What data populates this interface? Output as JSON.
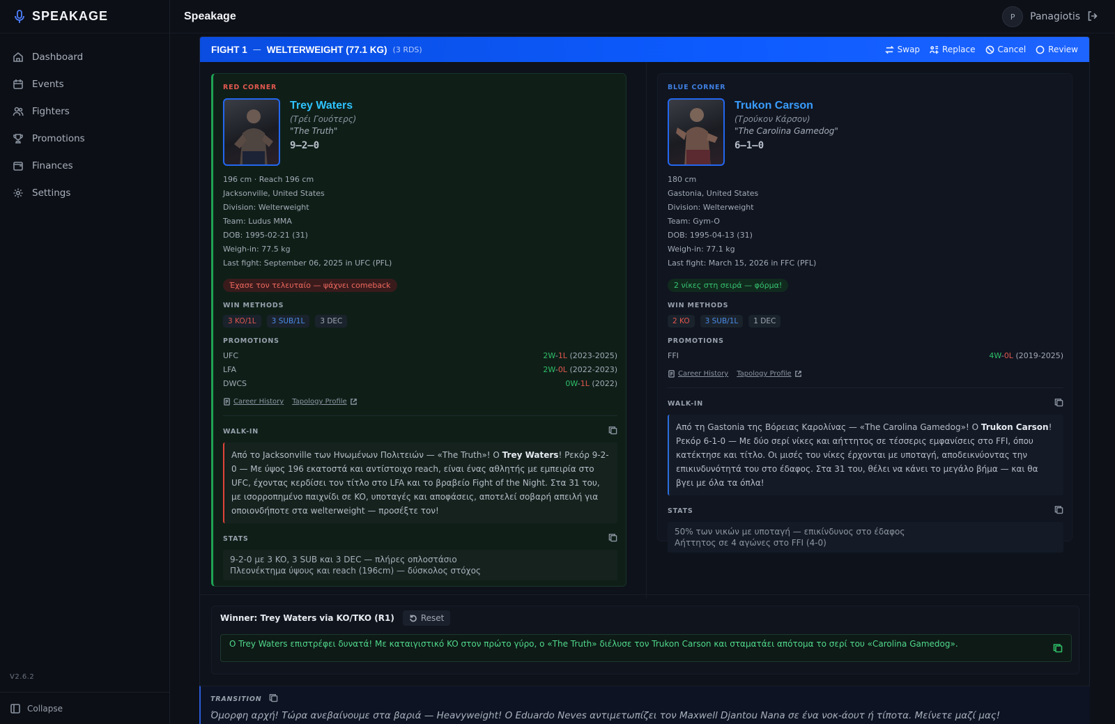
{
  "app": {
    "brand": "SPEAKAGE",
    "title": "Speakage",
    "version": "V2.6.2",
    "collapse_label": "Collapse"
  },
  "sidebar": {
    "items": [
      {
        "label": "Dashboard",
        "icon": "home-icon"
      },
      {
        "label": "Events",
        "icon": "calendar-icon"
      },
      {
        "label": "Fighters",
        "icon": "users-icon"
      },
      {
        "label": "Promotions",
        "icon": "trophy-icon"
      },
      {
        "label": "Finances",
        "icon": "wallet-icon"
      },
      {
        "label": "Settings",
        "icon": "gear-icon"
      }
    ]
  },
  "user": {
    "initial": "P",
    "name": "Panagiotis"
  },
  "fight": {
    "number": "FIGHT 1",
    "division": "WELTERWEIGHT (77.1 KG)",
    "rounds": "(3 RDS)",
    "actions": {
      "swap": "Swap",
      "replace": "Replace",
      "cancel": "Cancel",
      "review": "Review"
    },
    "red": {
      "corner_label": "RED CORNER",
      "name": "Trey Waters",
      "greek": "(Τρέι Γουότερς)",
      "nickname": "\"The Truth\"",
      "record": "9–2–0",
      "info": [
        "196 cm · Reach 196 cm",
        "Jacksonville, United States",
        "Division: Welterweight",
        "Team: Ludus MMA",
        "DOB: 1995-02-21 (31)",
        "Weigh-in: 77.5 kg",
        "Last fight: September 06, 2025 in UFC (PFL)"
      ],
      "badge": "Έχασε τον τελευταίο — ψάχνει comeback",
      "win_methods_label": "WIN METHODS",
      "methods": {
        "ko": "3 KO/1L",
        "sub": "3 SUB/1L",
        "dec": "3 DEC"
      },
      "promotions_label": "PROMOTIONS",
      "promotions": [
        {
          "name": "UFC",
          "w": "2W",
          "l": "1L",
          "years": "(2023-2025)"
        },
        {
          "name": "LFA",
          "w": "2W",
          "l": "0L",
          "years": "(2022-2023)"
        },
        {
          "name": "DWCS",
          "w": "0W",
          "l": "1L",
          "years": "(2022)"
        }
      ],
      "career_link": "Career History",
      "tapology_link": "Tapology Profile",
      "walkin_label": "WALK-IN",
      "walkin_pre": "Από το Jacksonville των Ηνωμένων Πολιτειών — «The Truth»! Ο ",
      "walkin_bold": "Trey Waters",
      "walkin_post": "! Ρεκόρ 9-2-0 — Με ύψος 196 εκατοστά και αντίστοιχο reach, είναι ένας αθλητής με εμπειρία στο UFC, έχοντας κερδίσει τον τίτλο στο LFA και το βραβείο Fight of the Night. Στα 31 του, με ισορροπημένο παιχνίδι σε KO, υποταγές και αποφάσεις, αποτελεί σοβαρή απειλή για οποιονδήποτε στα welterweight — προσέξτε τον!",
      "stats_label": "STATS",
      "stats": [
        "9-2-0 με 3 KO, 3 SUB και 3 DEC — πλήρες οπλοστάσιο",
        "Πλεονέκτημα ύψους και reach (196cm) — δύσκολος στόχος"
      ]
    },
    "blue": {
      "corner_label": "BLUE CORNER",
      "name": "Trukon Carson",
      "greek": "(Τρούκον Κάρσον)",
      "nickname": "\"The Carolina Gamedog\"",
      "record": "6–1–0",
      "info": [
        "180 cm",
        "Gastonia, United States",
        "Division: Welterweight",
        "Team: Gym-O",
        "DOB: 1995-04-13 (31)",
        "Weigh-in: 77.1 kg",
        "Last fight: March 15, 2026 in FFC (PFL)"
      ],
      "badge": "2 νίκες στη σειρά — φόρμα!",
      "win_methods_label": "WIN METHODS",
      "methods": {
        "ko": "2 KO",
        "sub": "3 SUB/1L",
        "dec": "1 DEC"
      },
      "promotions_label": "PROMOTIONS",
      "promotions": [
        {
          "name": "FFI",
          "w": "4W",
          "l": "0L",
          "years": "(2019-2025)"
        }
      ],
      "career_link": "Career History",
      "tapology_link": "Tapology Profile",
      "walkin_label": "WALK-IN",
      "walkin_pre": "Από τη Gastonia της Βόρειας Καρολίνας — «The Carolina Gamedog»! Ο ",
      "walkin_bold": "Trukon Carson",
      "walkin_post": "! Ρεκόρ 6-1-0 — Με δύο σερί νίκες και αήττητος σε τέσσερις εμφανίσεις στο FFI, όπου κατέκτησε και τίτλο. Οι μισές του νίκες έρχονται με υποταγή, αποδεικνύοντας την επικινδυνότητά του στο έδαφος. Στα 31 του, θέλει να κάνει το μεγάλο βήμα — και θα βγει με όλα τα όπλα!",
      "stats_label": "STATS",
      "stats": [
        "50% των νικών με υποταγή — επικίνδυνος στο έδαφος",
        "Αήττητος σε 4 αγώνες στο FFI (4-0)"
      ]
    },
    "result": {
      "winner": "Winner: Trey Waters via KO/TKO (R1)",
      "reset": "Reset",
      "text": "Ο Trey Waters επιστρέφει δυνατά! Με καταιγιστικό KO στον πρώτο γύρο, ο «The Truth» διέλυσε τον Trukon Carson και σταματάει απότομα το σερί του «Carolina Gamedog»."
    }
  },
  "transition": {
    "label": "TRANSITION",
    "text": "Όμορφη αρχή! Τώρα ανεβαίνουμε στα βαριά — Heavyweight! Ο Eduardo Neves αντιμετωπίζει τον Maxwell Djantou Nana σε ένα νοκ-άουτ ή τίποτα. Μείνετε μαζί μας!"
  }
}
